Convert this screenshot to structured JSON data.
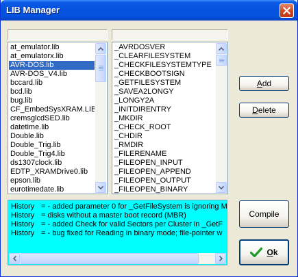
{
  "window": {
    "title": "LIB Manager"
  },
  "libraries": {
    "items": [
      "at_emulator.lib",
      "at_emulatorx.lib",
      "AVR-DOS.lib",
      "AVR-DOS_V4.lib",
      "bccard.lib",
      "bcd.lib",
      "bug.lib",
      "CF_EmbedSysXRAM.LIB",
      "cremsglcdSED.lib",
      "datetime.lib",
      "Double.lib",
      "Double_Trig.lib",
      "Double_Trig4.lib",
      "ds1307clock.lib",
      "EDTP_XRAMDrive0.lib",
      "epson.lib",
      "eurotimedate.lib"
    ],
    "selected": "AVR-DOS.lib"
  },
  "routines": {
    "items": [
      "_AVRDOSVER",
      "_CLEARFILESYSTEM",
      "_CHECKFILESYSTEMTYPE",
      "_CHECKBOOTSIGN",
      "_GETFILESYSTEM",
      "_SAVEA2LONGY",
      "_LONGY2A",
      "_INITDIRENTRY",
      "_MKDIR",
      "_CHECK_ROOT",
      "_CHDIR",
      "_RMDIR",
      "_FILERENAME",
      "_FILEOPEN_INPUT",
      "_FILEOPEN_APPEND",
      "_FILEOPEN_OUTPUT",
      "_FILEOPEN_BINARY"
    ]
  },
  "buttons": {
    "add": {
      "label": "Add",
      "accel": "A",
      "rest": "dd"
    },
    "delete": {
      "label": "Delete",
      "accel": "D",
      "rest": "elete"
    },
    "compile": {
      "label": "Compile"
    },
    "ok": {
      "label": "Ok",
      "accel": "O",
      "rest": "k"
    }
  },
  "history": [
    {
      "key": "History",
      "text": "= - added parameter 0 for _GetFileSystem is ignoring M"
    },
    {
      "key": "History",
      "text": "=   disks without a master boot record (MBR)"
    },
    {
      "key": "History",
      "text": "= - added Check for valid Sectors per Cluster in _GetF"
    },
    {
      "key": "History",
      "text": "= - bug fixed for Reading in binary mode; file-pointer w"
    }
  ],
  "colors": {
    "history_bg": "#00ffff",
    "selection": "#316ac5",
    "ok_check": "#1d9a2b"
  }
}
